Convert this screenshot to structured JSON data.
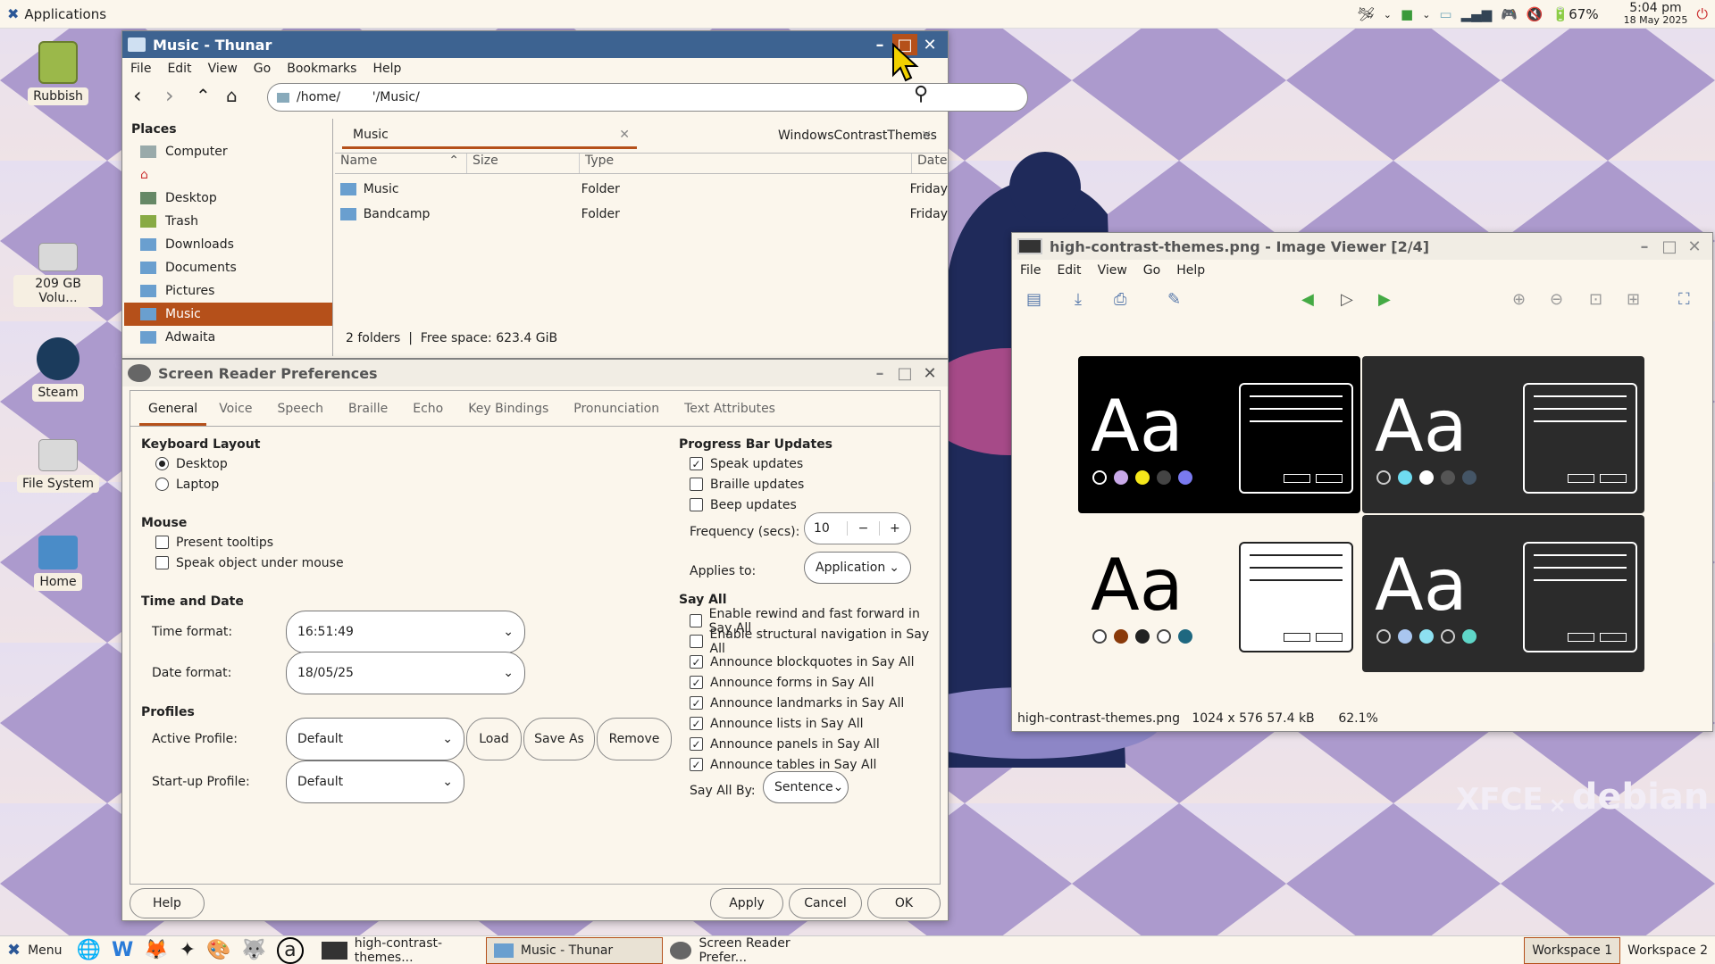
{
  "topbar": {
    "applications": "Applications",
    "battery": "67%",
    "time": "5:04 pm",
    "date": "18 May 2025"
  },
  "desktop": {
    "icons": [
      {
        "label": "Rubbish"
      },
      {
        "label": "209 GB Volu..."
      },
      {
        "label": "Steam"
      },
      {
        "label": "File System"
      },
      {
        "label": "Home"
      }
    ]
  },
  "thunar": {
    "title": "Music - Thunar",
    "menu": [
      "File",
      "Edit",
      "View",
      "Go",
      "Bookmarks",
      "Help"
    ],
    "path": "/home/        '/Music/",
    "places_header": "Places",
    "places": [
      "Computer",
      "",
      "Desktop",
      "Trash",
      "Downloads",
      "Documents",
      "Pictures",
      "Music",
      "Adwaita"
    ],
    "tabs": [
      "Music",
      "WindowsContrastThemes"
    ],
    "columns": [
      "Name",
      "Size",
      "Type",
      "Date"
    ],
    "rows": [
      {
        "name": "Music",
        "type": "Folder",
        "date": "Friday"
      },
      {
        "name": "Bandcamp",
        "type": "Folder",
        "date": "Friday"
      }
    ],
    "status": "2 folders  |  Free space: 623.4 GiB"
  },
  "viewer": {
    "title": "high-contrast-themes.png - Image Viewer [2/4]",
    "menu": [
      "File",
      "Edit",
      "View",
      "Go",
      "Help"
    ],
    "status": "high-contrast-themes.png   1024 x 576 57.4 kB      62.1%",
    "thumb_text": "Aa"
  },
  "orca": {
    "title": "Screen Reader Preferences",
    "tabs": [
      "General",
      "Voice",
      "Speech",
      "Braille",
      "Echo",
      "Key Bindings",
      "Pronunciation",
      "Text Attributes"
    ],
    "keyboard": {
      "label": "Keyboard Layout",
      "options": [
        "Desktop",
        "Laptop"
      ]
    },
    "mouse": {
      "label": "Mouse",
      "options": [
        "Present tooltips",
        "Speak object under mouse"
      ]
    },
    "timedate": {
      "label": "Time and Date",
      "time_label": "Time format:",
      "time_value": "16:51:49",
      "date_label": "Date format:",
      "date_value": "18/05/25"
    },
    "profiles": {
      "label": "Profiles",
      "active_label": "Active Profile:",
      "active_value": "Default",
      "load": "Load",
      "save_as": "Save As",
      "remove": "Remove",
      "startup_label": "Start-up Profile:",
      "startup_value": "Default"
    },
    "progress": {
      "label": "Progress Bar Updates",
      "options": [
        "Speak updates",
        "Braille updates",
        "Beep updates"
      ],
      "freq_label": "Frequency (secs):",
      "freq_value": "10",
      "applies_label": "Applies to:",
      "applies_value": "Application"
    },
    "sayall": {
      "label": "Say All",
      "options": [
        "Enable rewind and fast forward in Say All",
        "Enable structural navigation in Say All",
        "Announce blockquotes in Say All",
        "Announce forms in Say All",
        "Announce landmarks in Say All",
        "Announce lists in Say All",
        "Announce panels in Say All",
        "Announce tables in Say All"
      ],
      "by_label": "Say All By:",
      "by_value": "Sentence"
    },
    "buttons": {
      "help": "Help",
      "apply": "Apply",
      "cancel": "Cancel",
      "ok": "OK"
    }
  },
  "taskbar": {
    "menu": "Menu",
    "tasks": [
      "high-contrast-themes...",
      "Music - Thunar",
      "Screen Reader Prefer..."
    ],
    "workspaces": [
      "Workspace 1",
      "Workspace 2"
    ]
  },
  "brand": {
    "xfce": "XFCE",
    "x": "×",
    "debian": "debian"
  }
}
